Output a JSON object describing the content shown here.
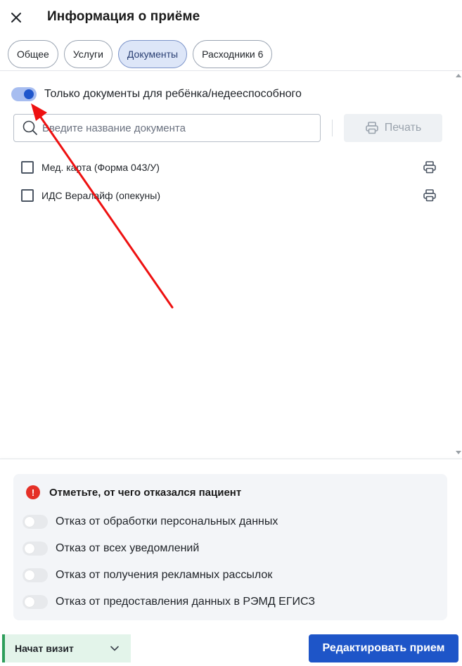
{
  "header": {
    "title": "Информация о приёме",
    "close_icon": "close-icon"
  },
  "tabs": [
    {
      "label": "Общее",
      "active": false
    },
    {
      "label": "Услуги",
      "active": false
    },
    {
      "label": "Документы",
      "active": true
    },
    {
      "label": "Расходники 6",
      "active": false
    }
  ],
  "documents": {
    "filter_toggle": {
      "label": "Только документы для ребёнка/недееспособного",
      "on": true
    },
    "search": {
      "placeholder": "Введите название документа",
      "value": ""
    },
    "print_button": {
      "label": "Печать",
      "enabled": false
    },
    "items": [
      {
        "label": "Мед. карта (Форма 043/У)",
        "checked": false
      },
      {
        "label": "ИДС Вералайф (опекуны)",
        "checked": false
      }
    ]
  },
  "refusal": {
    "title": "Отметьте, от чего отказался пациент",
    "items": [
      {
        "label": "Отказ от обработки персональных данных",
        "on": false
      },
      {
        "label": "Отказ от всех уведомлений",
        "on": false
      },
      {
        "label": "Отказ от получения рекламных рассылок",
        "on": false
      },
      {
        "label": "Отказ от предоставления данных в РЭМД ЕГИСЗ",
        "on": false
      }
    ]
  },
  "footer": {
    "status_value": "Начат визит",
    "edit_button": "Редактировать прием"
  },
  "colors": {
    "accent": "#1e55c8",
    "toggle_on_track": "#a7bdf0",
    "alert": "#e53027",
    "status_green": "#2e9e5b",
    "annotation_arrow": "#ee1111"
  }
}
